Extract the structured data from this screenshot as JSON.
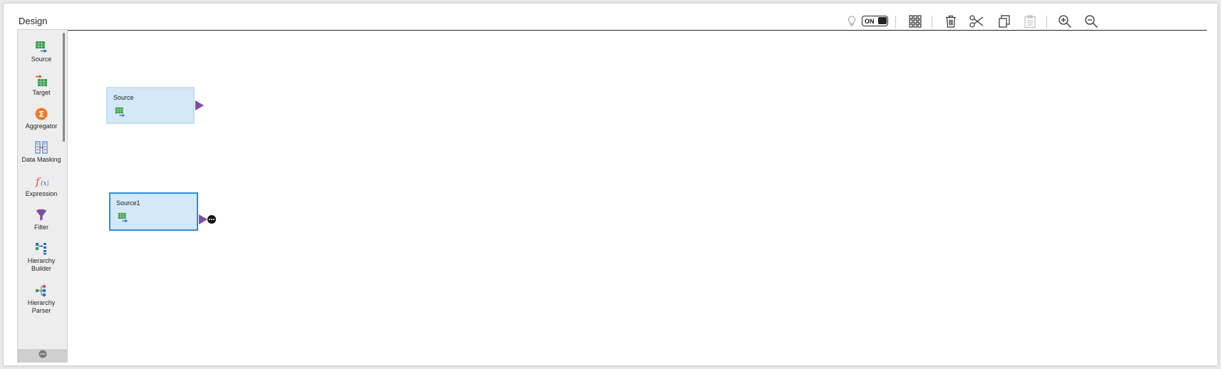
{
  "header": {
    "title": "Design"
  },
  "toolbar": {
    "toggle_label": "ON",
    "icons": [
      "lightbulb-icon",
      "toggle-switch",
      "grid-icon",
      "trash-icon",
      "scissors-icon",
      "copy-icon",
      "paste-icon",
      "zoom-in-icon",
      "zoom-out-icon"
    ]
  },
  "palette": {
    "items": [
      {
        "label": "Source",
        "icon": "source-icon"
      },
      {
        "label": "Target",
        "icon": "target-icon"
      },
      {
        "label": "Aggregator",
        "icon": "aggregator-icon"
      },
      {
        "label": "Data Masking",
        "icon": "data-masking-icon"
      },
      {
        "label": "Expression",
        "icon": "expression-icon"
      },
      {
        "label": "Filter",
        "icon": "filter-icon"
      },
      {
        "label": "Hierarchy Builder",
        "icon": "hierarchy-builder-icon"
      },
      {
        "label": "Hierarchy Parser",
        "icon": "hierarchy-parser-icon"
      }
    ],
    "footer_icon": "more-icon"
  },
  "canvas": {
    "nodes": [
      {
        "title": "Source",
        "selected": false
      },
      {
        "title": "Source1",
        "selected": true
      }
    ]
  },
  "colors": {
    "node_fill": "#d3e8f8",
    "node_selected_border": "#2b8fe0",
    "port": "#7b4fa0",
    "aggregator": "#f07a2a"
  }
}
